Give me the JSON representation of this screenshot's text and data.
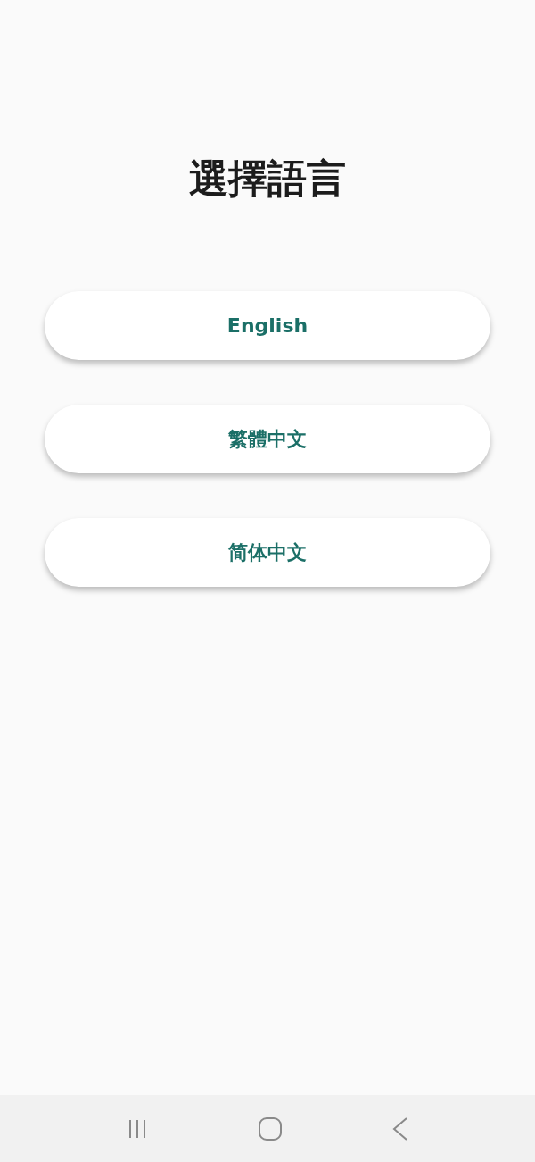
{
  "title": "選擇語言",
  "languages": [
    {
      "label": "English"
    },
    {
      "label": "繁體中文"
    },
    {
      "label": "简体中文"
    }
  ]
}
